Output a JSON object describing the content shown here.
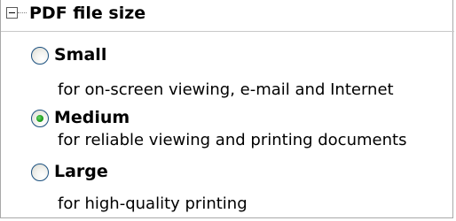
{
  "section": {
    "title": "PDF file size",
    "expanded": true
  },
  "options": [
    {
      "label": "Small",
      "description": "for on-screen viewing, e-mail and Internet",
      "selected": false
    },
    {
      "label": "Medium",
      "description": "for reliable viewing and printing documents",
      "selected": true
    },
    {
      "label": "Large",
      "description": "for high-quality printing",
      "selected": false
    }
  ],
  "colors": {
    "radio_border": "#1c5180",
    "radio_selected_dot": "#21a121",
    "panel_border": "#a9a9a9"
  }
}
